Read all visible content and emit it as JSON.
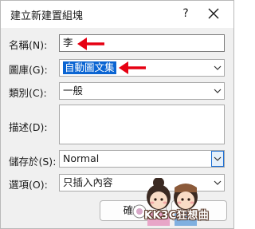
{
  "dialog": {
    "title": "建立新建置組塊",
    "help_glyph": "?",
    "close_icon": "close-icon"
  },
  "fields": {
    "name": {
      "label": "名稱(N):",
      "value": "李"
    },
    "gallery": {
      "label": "圖庫(G):",
      "value": "自動圖文集"
    },
    "category": {
      "label": "類別(C):",
      "value": "一般"
    },
    "description": {
      "label": "描述(D):",
      "value": ""
    },
    "save_in": {
      "label": "儲存於(S):",
      "value": "Normal"
    },
    "options": {
      "label": "選項(O):",
      "value": "只插入內容"
    }
  },
  "buttons": {
    "ok_label": "確定"
  },
  "annotations": {
    "arrow_color": "#e60012",
    "watermark_text": "KK3C狂想曲"
  },
  "colors": {
    "selection": "#0a64d2",
    "focus_border": "#1d6fd4"
  }
}
